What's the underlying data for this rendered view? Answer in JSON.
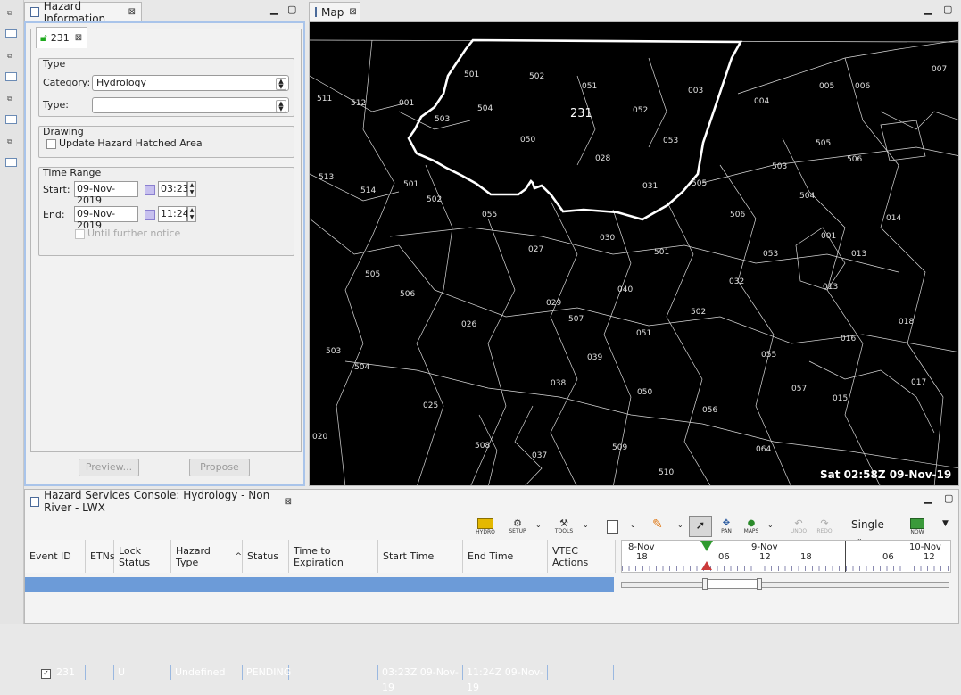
{
  "left_strip": {
    "icons": [
      "view-icon",
      "view-icon",
      "view-icon",
      "view-icon",
      "view-icon",
      "view-icon"
    ]
  },
  "hazard_view": {
    "tab_title": "Hazard Information",
    "event_tab": "231",
    "type_group": "Type",
    "category_label": "Category:",
    "category_value": "Hydrology",
    "type_label": "Type:",
    "type_value": "",
    "drawing_group": "Drawing",
    "update_hatched": "Update Hazard Hatched Area",
    "time_group": "Time Range",
    "start_label": "Start:",
    "start_date": "09-Nov-2019",
    "start_time": "03:23",
    "end_label": "End:",
    "end_date": "09-Nov-2019",
    "end_time": "11:24",
    "until_further": "Until further notice",
    "preview_button": "Preview...",
    "propose_button": "Propose"
  },
  "map_view": {
    "tab_title": "Map",
    "status": "Sat 02:58Z 09-Nov-19",
    "hazard_label": "231",
    "zone_labels": [
      "501",
      "502",
      "051",
      "003",
      "004",
      "005",
      "006",
      "007",
      "511",
      "512",
      "001",
      "503",
      "504",
      "052",
      "050",
      "053",
      "231",
      "028",
      "505",
      "503",
      "506",
      "513",
      "514",
      "501",
      "502",
      "031",
      "505",
      "504",
      "001",
      "014",
      "055",
      "506",
      "030",
      "501",
      "053",
      "013",
      "027",
      "505",
      "506",
      "029",
      "040",
      "032",
      "502",
      "013",
      "026",
      "507",
      "018",
      "016",
      "051",
      "503",
      "039",
      "504",
      "038",
      "055",
      "050",
      "057",
      "017",
      "025",
      "056",
      "015",
      "020",
      "508",
      "037",
      "509",
      "064",
      "510"
    ]
  },
  "console": {
    "tab_title": "Hazard Services Console: Hydrology - Non River - LWX",
    "toolbar": {
      "hydro": "HYDRO",
      "setup": "SETUP",
      "tools": "TOOLS",
      "pan": "PAN",
      "maps": "MAPS",
      "undo": "UNDO",
      "redo": "REDO",
      "mode": "Single",
      "now": "NOW"
    },
    "columns": [
      "Event ID",
      "ETNs",
      "Lock Status",
      "Hazard Type",
      "Status",
      "Time to Expiration",
      "Start Time",
      "End Time",
      "VTEC Actions"
    ],
    "row": {
      "event_id": "231",
      "etns": "",
      "lock_status": "U",
      "hazard_type": "Undefined",
      "status": "PENDING",
      "time_to_expiration": "",
      "start_time": "03:23Z 09-Nov-19",
      "end_time": "11:24Z 09-Nov-19",
      "vtec_actions": ""
    },
    "timeline": {
      "day_labels": [
        "8-Nov",
        "9-Nov",
        "10-Nov"
      ],
      "hour_labels": [
        "18",
        "06",
        "12",
        "18",
        "06",
        "12"
      ]
    }
  },
  "colors": {
    "selection": "#6c9bd8",
    "hazard_outline": "#ffffff",
    "map_bg": "#000000",
    "marker_green": "#2f9a2f",
    "marker_red": "#cc3a3a"
  }
}
